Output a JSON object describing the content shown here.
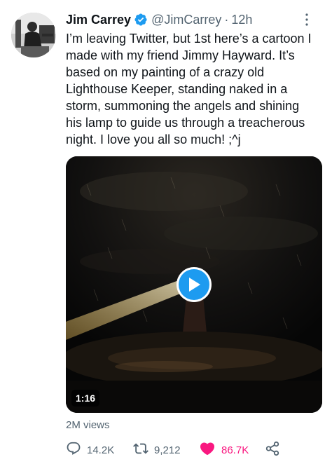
{
  "tweet": {
    "display_name": "Jim Carrey",
    "handle": "@JimCarrey",
    "separator": "·",
    "time": "12h",
    "text_lines": [
      "I’m leaving Twitter, but 1st here’s a cartoon I",
      "made with my friend Jimmy Hayward. It’s",
      "based on my painting of a crazy old",
      "Lighthouse Keeper, standing naked in a",
      "storm, summoning the angels and shining",
      "his lamp to guide us through a treacherous",
      "night. I love you all so much! ;^j"
    ],
    "views": "2M views"
  },
  "media": {
    "type": "video",
    "duration": "1:16",
    "play_icon": "play-icon"
  },
  "actions": {
    "reply": {
      "icon": "reply-icon",
      "count": "14.2K"
    },
    "retweet": {
      "icon": "retweet-icon",
      "count": "9,212"
    },
    "like": {
      "icon": "heart-icon",
      "count": "86.7K",
      "liked": true
    },
    "share": {
      "icon": "share-icon"
    }
  },
  "colors": {
    "accent": "#1d9bf0",
    "like": "#f91880",
    "secondary_text": "#536471",
    "primary_text": "#0f1419"
  }
}
